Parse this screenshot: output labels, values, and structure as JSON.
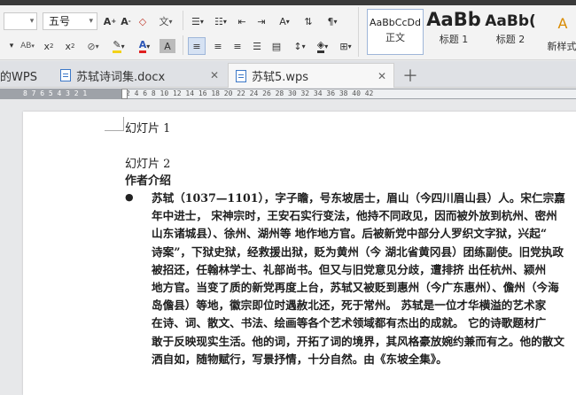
{
  "ribbon": {
    "font_size": "五号",
    "row1_icons": [
      "increase-font-icon",
      "decrease-font-icon",
      "clear-format-icon",
      "phonetic-icon",
      "bullet-list-icon",
      "numbered-list-icon",
      "decrease-indent-icon",
      "increase-indent-icon",
      "chinese-layout-icon",
      "sort-icon",
      "show-marks-icon"
    ],
    "row2_icons": [
      "superscript-icon",
      "subscript-icon",
      "highlight-icon",
      "font-color-icon",
      "char-shading-icon",
      "align-left-icon",
      "align-center-icon",
      "align-right-icon",
      "justify-icon",
      "distribute-icon",
      "line-spacing-icon",
      "shading-icon",
      "border-icon"
    ],
    "styles": [
      {
        "sample": "AaBbCcDd",
        "caption": "正文"
      },
      {
        "sample": "AaBb",
        "caption": "标题 1"
      },
      {
        "sample": "AaBb(",
        "caption": "标题 2"
      }
    ],
    "new_style_label": "新样式"
  },
  "tabs": [
    {
      "label": "的WPS"
    },
    {
      "label": "苏轼诗词集.docx"
    },
    {
      "label": "苏轼5.wps"
    }
  ],
  "ruler": {
    "left_numbers": "8 7 6 5 4 3 2 1",
    "right_numbers": "2  4  6  8  10  12  14  16  18  20  22  24  26  28  30  32  34  36  38  40  42"
  },
  "document": {
    "slide1": "幻灯片 1",
    "slide2": "幻灯片 2",
    "heading": "作者介绍",
    "bullet": "●",
    "paragraph_lines": [
      "苏轼（1037—1101），字子瞻，号东坡居士，眉山（今四川眉山县）人。宋仁宗嘉",
      "年中进士， 宋神宗时，王安石实行变法，他持不同政见，因而被外放到杭州、密州",
      "山东诸城县）、徐州、湖州等 地作地方官。后被新党中部分人罗织文字狱，兴起“",
      "诗案”，下狱史狱，经救援出狱，贬为黄州（今 湖北省黄冈县）团练副使。旧党执政",
      "被招还，任翰林学士、礼部尚书。但又与旧党意见分歧，遭排挤 出任杭州、颍州",
      "地方官。当变了质的新党再度上台，苏轼又被贬到惠州（今广东惠州）、儋州（今海",
      "岛儋县）等地，徽宗即位时遇赦北还，死于常州。  苏轼是一位才华横溢的艺术家",
      "在诗、词、散文、书法、绘画等各个艺术领域都有杰出的成就。  它的诗歌题材广",
      "敢于反映现实生活。他的词，开拓了词的境界，其风格豪放婉约兼而有之。他的散文",
      "洒自如，随物赋行，写景抒情，十分自然。由《东坡全集》。"
    ]
  }
}
